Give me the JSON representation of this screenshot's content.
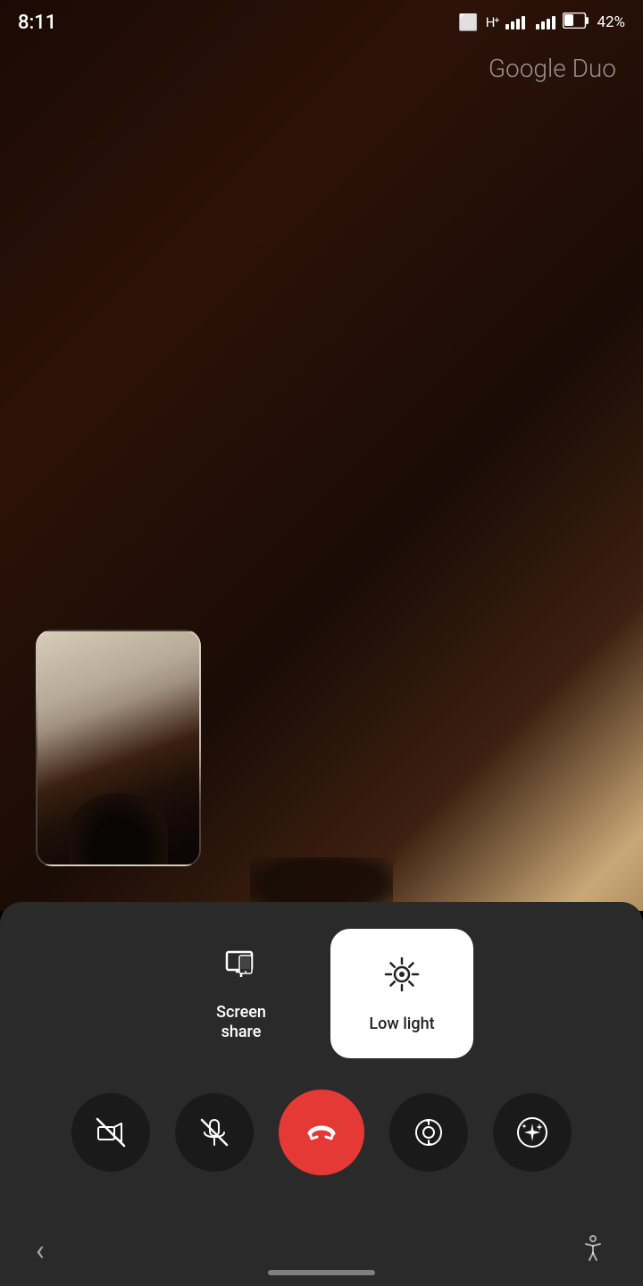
{
  "statusBar": {
    "time": "8:11",
    "battery": "42%",
    "batteryIcon": "🔋"
  },
  "app": {
    "name": "Google Duo"
  },
  "toolbar": {
    "screenShare": {
      "label": "Screen\nshare",
      "labelLine1": "Screen",
      "labelLine2": "share"
    },
    "lowLight": {
      "label": "Low light"
    }
  },
  "controls": {
    "videoOff": "video-off",
    "muteOn": "mute",
    "hangUp": "hang-up",
    "flipCamera": "flip-camera",
    "effects": "effects"
  },
  "nav": {
    "back": "‹",
    "accessibility": "accessibility"
  }
}
